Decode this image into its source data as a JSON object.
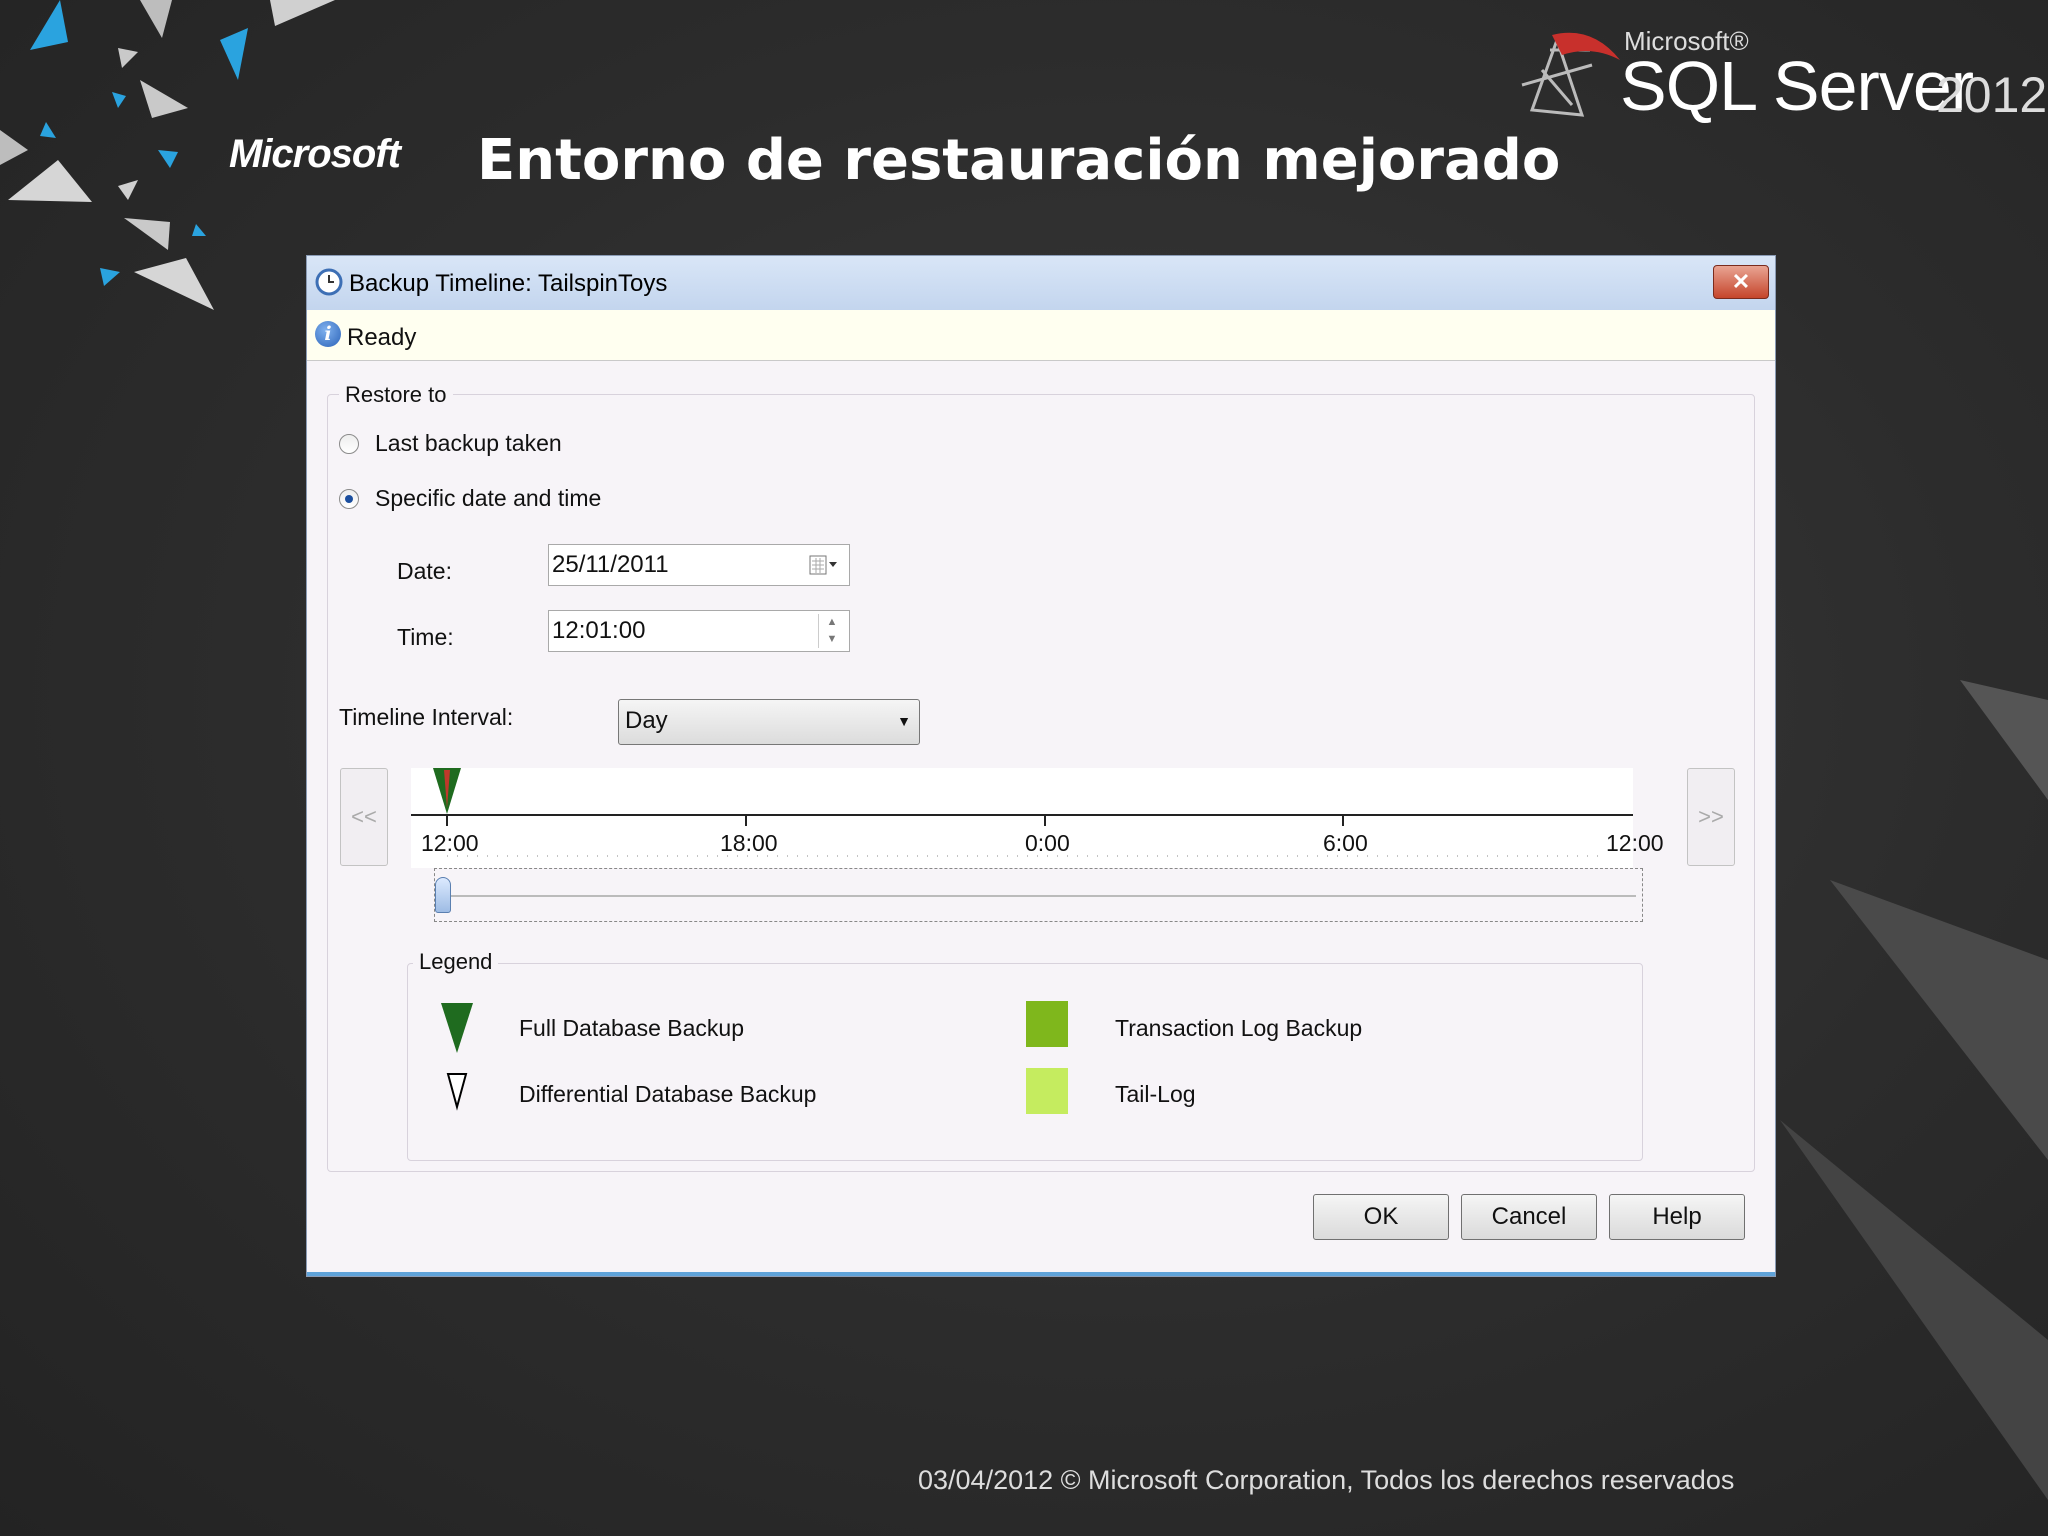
{
  "slide": {
    "brand": "Microsoft",
    "title": "Entorno de restauración mejorado",
    "product_prefix": "Microsoft®",
    "product_name": "SQL Server",
    "product_year": "2012",
    "footer": "03/04/2012  © Microsoft Corporation, Todos los derechos reservados"
  },
  "dialog": {
    "title": "Backup Timeline: TailspinToys",
    "close_label": "✕",
    "status": "Ready",
    "restore_group_label": "Restore to",
    "restore_options": [
      {
        "label": "Last backup taken",
        "selected": false
      },
      {
        "label": "Specific date and time",
        "selected": true
      }
    ],
    "date_label": "Date:",
    "date_value": "25/11/2011",
    "time_label": "Time:",
    "time_value": "12:01:00",
    "interval_label": "Timeline Interval:",
    "interval_value": "Day",
    "nav_prev": "<<",
    "nav_next": ">>",
    "timeline_ticks": [
      "12:00",
      "18:00",
      "0:00",
      "6:00",
      "12:00"
    ],
    "legend_label": "Legend",
    "legend": {
      "full": "Full Database Backup",
      "diff": "Differential Database Backup",
      "log": "Transaction Log Backup",
      "tail": "Tail-Log"
    },
    "buttons": {
      "ok": "OK",
      "cancel": "Cancel",
      "help": "Help"
    }
  },
  "colors": {
    "full_backup": "#1f6b1f",
    "full_backup_accent": "#c0392b",
    "transaction_log": "#7fb71c",
    "tail_log": "#c5ec5f",
    "accent_blue": "#27a7e0"
  }
}
